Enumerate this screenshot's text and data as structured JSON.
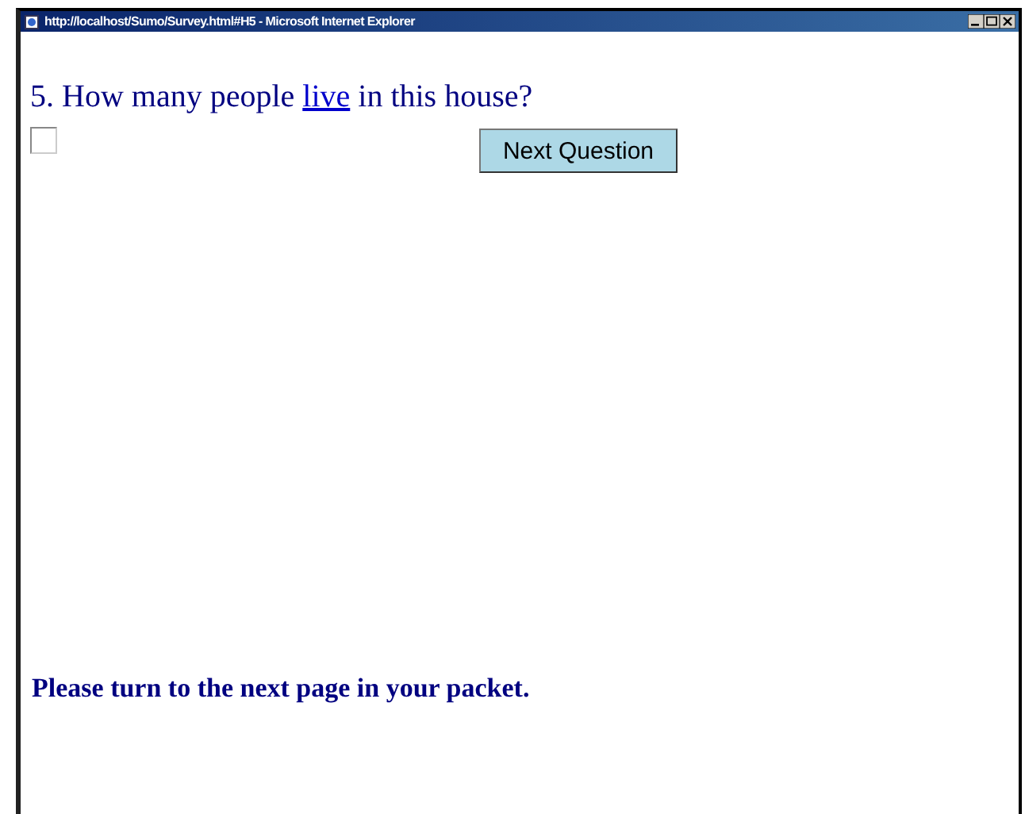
{
  "window": {
    "title": "http://localhost/Sumo/Survey.html#H5 - Microsoft Internet Explorer"
  },
  "question": {
    "prefix": "5. How many people ",
    "link": "live",
    "suffix": " in this house?"
  },
  "answer": {
    "checked": false
  },
  "next_button": {
    "label": "Next Question"
  },
  "footer": "Please turn to the next page in your packet."
}
